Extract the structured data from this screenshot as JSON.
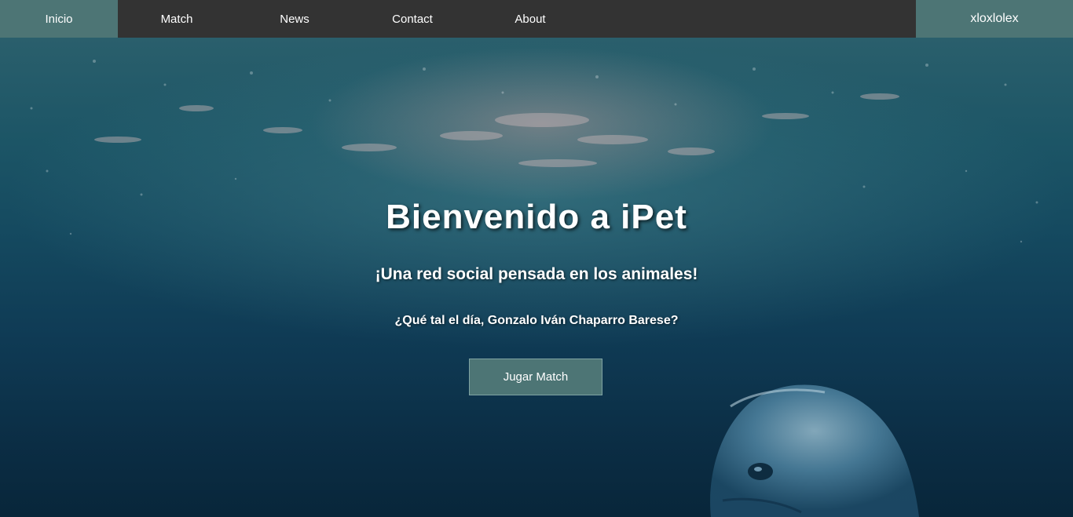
{
  "nav": {
    "items": [
      {
        "label": "Inicio",
        "active": true
      },
      {
        "label": "Match",
        "active": false
      },
      {
        "label": "News",
        "active": false
      },
      {
        "label": "Contact",
        "active": false
      },
      {
        "label": "About",
        "active": false
      }
    ],
    "user_label": "xloxlolex"
  },
  "hero": {
    "title": "Bienvenido a iPet",
    "subtitle": "¡Una red social pensada en los animales!",
    "greeting": "¿Qué tal el día, Gonzalo Iván Chaparro Barese?",
    "button_label": "Jugar Match",
    "background_image": "underwater-dolphin"
  },
  "colors": {
    "navbar_bg": "#333333",
    "accent": "#4d7575",
    "text": "#ffffff"
  }
}
